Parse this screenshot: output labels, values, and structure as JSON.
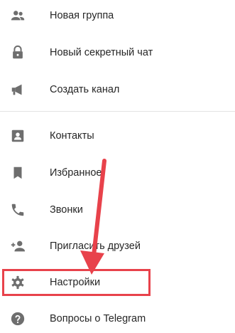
{
  "menu": {
    "items": [
      {
        "label": "Новая группа",
        "icon": "group-icon"
      },
      {
        "label": "Новый секретный чат",
        "icon": "lock-icon"
      },
      {
        "label": "Создать канал",
        "icon": "megaphone-icon"
      },
      {
        "label": "Контакты",
        "icon": "contact-card-icon"
      },
      {
        "label": "Избранное",
        "icon": "bookmark-icon"
      },
      {
        "label": "Звонки",
        "icon": "phone-icon"
      },
      {
        "label": "Пригласить друзей",
        "icon": "add-person-icon"
      },
      {
        "label": "Настройки",
        "icon": "gear-icon"
      },
      {
        "label": "Вопросы о Telegram",
        "icon": "help-icon"
      }
    ]
  },
  "annotation": {
    "highlight_color": "#e8424b",
    "target": "Настройки"
  },
  "colors": {
    "icon": "#6e6e6e",
    "text": "#262626",
    "divider": "#e3e3e3"
  }
}
